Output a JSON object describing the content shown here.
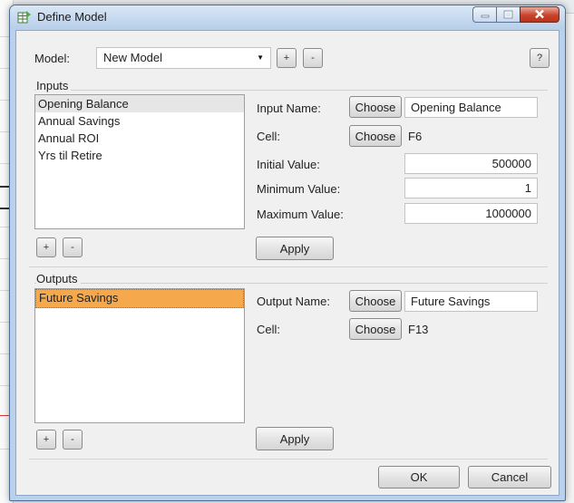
{
  "window": {
    "title": "Define Model",
    "accent": "#b9d1ea",
    "close_color": "#c8432c"
  },
  "model": {
    "label": "Model:",
    "selected": "New Model",
    "add_label": "+",
    "remove_label": "-",
    "help_label": "?"
  },
  "inputs": {
    "group_label": "Inputs",
    "items": [
      {
        "label": "Opening Balance"
      },
      {
        "label": "Annual Savings"
      },
      {
        "label": "Annual ROI"
      },
      {
        "label": "Yrs til Retire"
      }
    ],
    "add_label": "+",
    "remove_label": "-",
    "form": {
      "name_label": "Input Name:",
      "choose_label": "Choose",
      "name_value": "Opening Balance",
      "cell_label": "Cell:",
      "cell_choose_label": "Choose",
      "cell_value": "F6",
      "initial_label": "Initial Value:",
      "initial_value": "500000",
      "min_label": "Minimum Value:",
      "min_value": "1",
      "max_label": "Maximum Value:",
      "max_value": "1000000",
      "apply_label": "Apply"
    }
  },
  "outputs": {
    "group_label": "Outputs",
    "items": [
      {
        "label": "Future Savings"
      }
    ],
    "add_label": "+",
    "remove_label": "-",
    "form": {
      "name_label": "Output Name:",
      "choose_label": "Choose",
      "name_value": "Future Savings",
      "cell_label": "Cell:",
      "cell_choose_label": "Choose",
      "cell_value": "F13",
      "apply_label": "Apply"
    }
  },
  "footer": {
    "ok_label": "OK",
    "cancel_label": "Cancel"
  },
  "icons": {
    "app": "table-icon",
    "minimize": "minimize-icon",
    "maximize": "maximize-icon",
    "close": "close-icon",
    "dropdown": "chevron-down-icon"
  }
}
